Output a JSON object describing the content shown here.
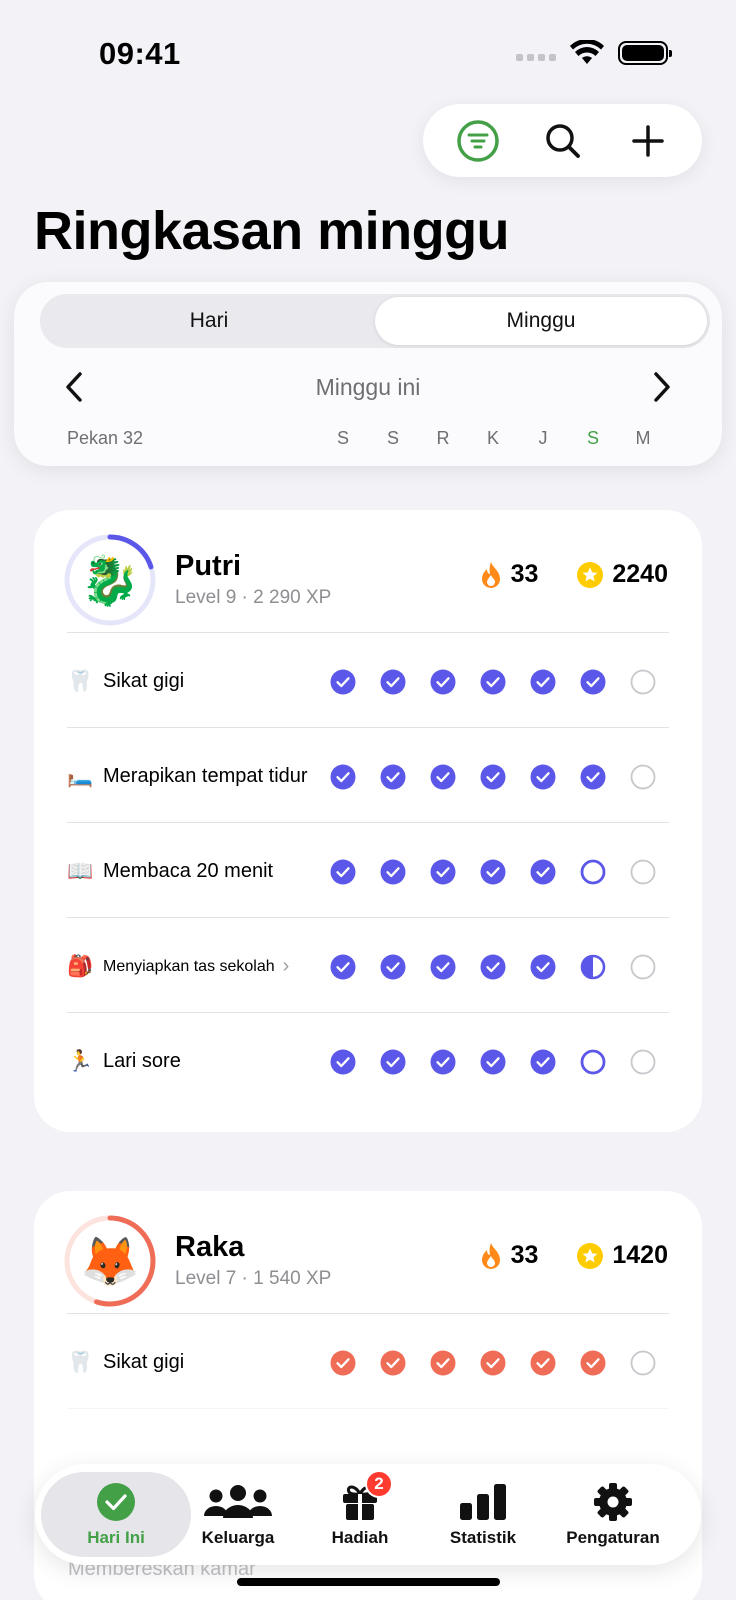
{
  "status": {
    "time": "09:41"
  },
  "page": {
    "title": "Ringkasan minggu"
  },
  "segment": {
    "day": "Hari",
    "week": "Minggu",
    "selected": "Minggu"
  },
  "week": {
    "label": "Minggu ini",
    "number": "Pekan 32",
    "days": [
      "S",
      "S",
      "R",
      "K",
      "J",
      "S",
      "M"
    ],
    "today_index": 5
  },
  "colors": {
    "accent": "#43a047",
    "putri": "#5b57e8",
    "raka": "#ef6c57",
    "empty": "#c7c7cc"
  },
  "people": [
    {
      "name": "Putri",
      "avatar": "🐉",
      "level": "Level 9 · 2 290 XP",
      "level_progress": 0.2,
      "streak": "33",
      "stars": "2240",
      "tasks": [
        {
          "emoji": "🦷",
          "name": "Sikat gigi",
          "days": [
            "done",
            "done",
            "done",
            "done",
            "done",
            "done",
            "empty"
          ]
        },
        {
          "emoji": "🛏️",
          "name": "Merapikan tempat tidur",
          "days": [
            "done",
            "done",
            "done",
            "done",
            "done",
            "done",
            "empty"
          ]
        },
        {
          "emoji": "📖",
          "name": "Membaca 20 menit",
          "days": [
            "done",
            "done",
            "done",
            "done",
            "done",
            "open",
            "empty"
          ]
        },
        {
          "emoji": "🎒",
          "name": "Menyiapkan tas sekolah",
          "days": [
            "done",
            "done",
            "done",
            "done",
            "done",
            "half",
            "empty"
          ],
          "has_detail": true
        },
        {
          "emoji": "🏃",
          "name": "Lari sore",
          "days": [
            "done",
            "done",
            "done",
            "done",
            "done",
            "open",
            "empty"
          ]
        }
      ]
    },
    {
      "name": "Raka",
      "avatar": "🦊",
      "level": "Level 7 · 1 540 XP",
      "level_progress": 0.55,
      "streak": "33",
      "stars": "1420",
      "tasks": [
        {
          "emoji": "🦷",
          "name": "Sikat gigi",
          "days": [
            "done",
            "done",
            "done",
            "done",
            "done",
            "done",
            "empty"
          ]
        }
      ]
    }
  ],
  "peek": {
    "text": "Membereskan kamar"
  },
  "tabs": [
    {
      "label": "Hari Ini",
      "icon": "checkmark-circle-icon"
    },
    {
      "label": "Keluarga",
      "icon": "people-icon"
    },
    {
      "label": "Hadiah",
      "icon": "gift-icon",
      "badge": "2"
    },
    {
      "label": "Statistik",
      "icon": "bar-chart-icon"
    },
    {
      "label": "Pengaturan",
      "icon": "gear-icon"
    }
  ]
}
